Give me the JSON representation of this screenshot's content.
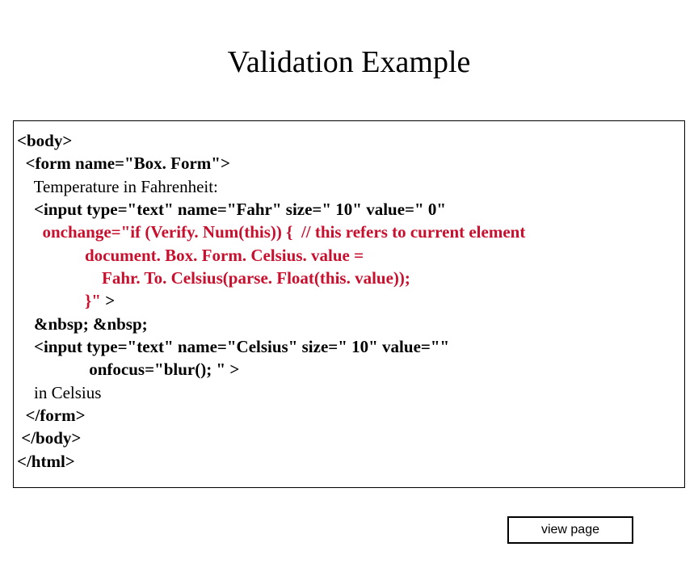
{
  "title": "Validation Example",
  "code": {
    "l1": "<body>",
    "l2": "  <form name=\"Box. Form\">",
    "l3": "    Temperature in Fahrenheit:",
    "l4a": "    <input type=\"text\" name=\"Fahr\" size=\" 10\" value=\" 0\"",
    "l5a": "      onchange=\"if (Verify. Num(this)) {  // this refers to current element",
    "l6a": "                document. Box. Form. Celsius. value =",
    "l7a": "                    Fahr. To. Celsius(parse. Float(this. value));",
    "l8a": "                }\"",
    "l8b": " >",
    "l9": "    &nbsp; &nbsp;",
    "l10": "    <input type=\"text\" name=\"Celsius\" size=\" 10\" value=\"\"",
    "l11": "                 onfocus=\"blur(); \" >",
    "l12": "    in Celsius",
    "l13": "  </form>",
    "l14": " </body>",
    "l15": "</html>"
  },
  "button": {
    "view_page": "view page"
  }
}
